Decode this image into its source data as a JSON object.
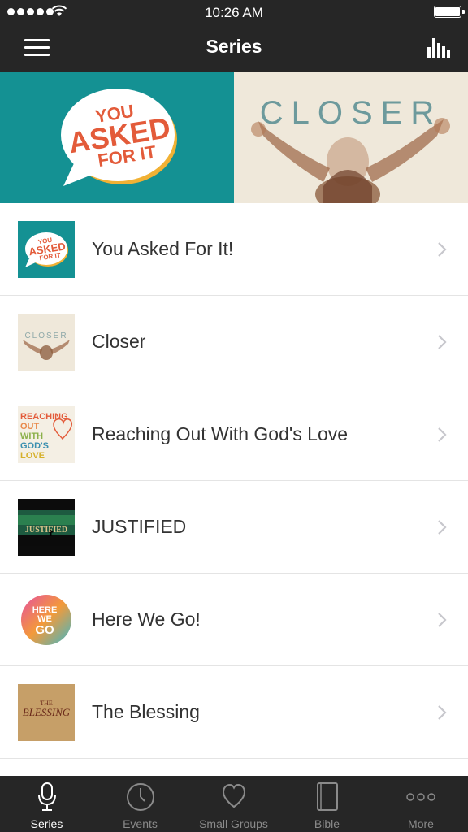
{
  "status_bar": {
    "time": "10:26 AM",
    "signal_icon": "signal-dots-icon",
    "wifi_icon": "wifi-icon",
    "battery_icon": "battery-icon"
  },
  "nav": {
    "title": "Series",
    "menu_icon": "hamburger-menu-icon",
    "stats_icon": "bar-chart-icon"
  },
  "banner": {
    "left": {
      "line1": "YOU",
      "line2": "ASKED",
      "line3": "FOR IT"
    },
    "right": {
      "title": "CLOSER"
    }
  },
  "series": [
    {
      "title": "You Asked For It!",
      "thumb": {
        "line1": "YOU",
        "line2": "ASKED",
        "line3": "FOR IT"
      }
    },
    {
      "title": "Closer",
      "thumb": {
        "line1": "CLOSER"
      }
    },
    {
      "title": "Reaching Out With God's Love",
      "thumb": {
        "line1": "REACHING",
        "line2": "OUT",
        "line3": "WITH",
        "line4": "GOD'S",
        "line5": "LOVE"
      }
    },
    {
      "title": "JUSTIFIED",
      "thumb": {
        "line1": "JUSTIFIED"
      }
    },
    {
      "title": "Here We Go!",
      "thumb": {
        "line1": "HERE",
        "line2": "WE",
        "line3": "GO"
      }
    },
    {
      "title": "The Blessing",
      "thumb": {
        "line1": "THE",
        "line2": "BLESSING"
      }
    }
  ],
  "tabs": [
    {
      "label": "Series",
      "icon": "microphone-icon",
      "active": true
    },
    {
      "label": "Events",
      "icon": "clock-icon",
      "active": false
    },
    {
      "label": "Small Groups",
      "icon": "heart-icon",
      "active": false
    },
    {
      "label": "Bible",
      "icon": "book-icon",
      "active": false
    },
    {
      "label": "More",
      "icon": "more-dots-icon",
      "active": false
    }
  ],
  "colors": {
    "bar_background": "#262626",
    "teal": "#149193",
    "accent_red": "#e35b3a"
  }
}
